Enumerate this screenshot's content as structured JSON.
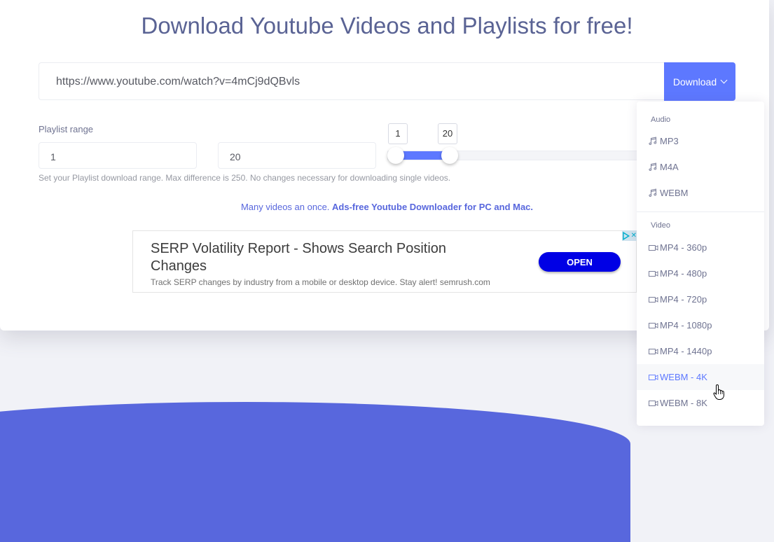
{
  "header": {
    "title": "Download Youtube Videos and Playlists for free!"
  },
  "url_input": {
    "value": "https://www.youtube.com/watch?v=4mCj9dQBvls"
  },
  "download_button": {
    "label": "Download",
    "icon": "chevron-down-icon"
  },
  "playlist": {
    "label": "Playlist range",
    "start_value": "1",
    "end_value": "20",
    "help_text": "Set your Playlist download range. Max difference is 250. No changes necessary for downloading single videos.",
    "slider": {
      "low": 1,
      "high": 20,
      "low_label": "1",
      "high_label": "20"
    }
  },
  "promo": {
    "text": "Many videos an once. ",
    "link": "Ads-free Youtube Downloader for PC and Mac."
  },
  "ad": {
    "title": "SERP Volatility Report - Shows Search Position Changes",
    "description": "Track SERP changes by industry from a mobile or desktop device. Stay alert! semrush.com",
    "button": "OPEN"
  },
  "menu": {
    "audio_header": "Audio",
    "audio": [
      {
        "label": "MP3",
        "icon": "music-note-icon"
      },
      {
        "label": "M4A",
        "icon": "music-note-icon"
      },
      {
        "label": "WEBM",
        "icon": "music-note-icon"
      }
    ],
    "video_header": "Video",
    "video": [
      {
        "label": "MP4 - 360p",
        "icon": "video-camera-icon"
      },
      {
        "label": "MP4 - 480p",
        "icon": "video-camera-icon"
      },
      {
        "label": "MP4 - 720p",
        "icon": "video-camera-icon"
      },
      {
        "label": "MP4 - 1080p",
        "icon": "video-camera-icon"
      },
      {
        "label": "MP4 - 1440p",
        "icon": "video-camera-icon"
      },
      {
        "label": "WEBM - 4K",
        "icon": "video-camera-icon",
        "hovered": true
      },
      {
        "label": "WEBM - 8K",
        "icon": "video-camera-icon"
      }
    ]
  },
  "colors": {
    "accent": "#5d78ff",
    "title": "#5a6394",
    "wave": "#5867dd",
    "ad_button": "#0000e5"
  }
}
